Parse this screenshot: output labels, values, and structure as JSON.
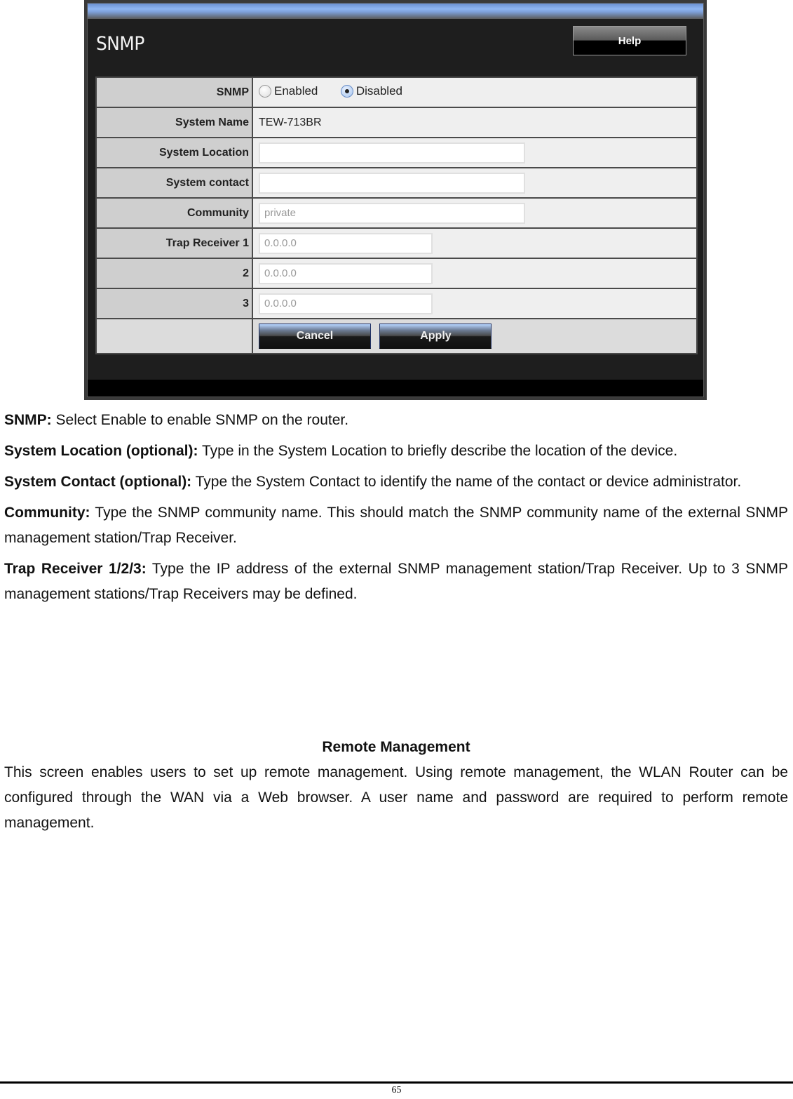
{
  "panel": {
    "title": "SNMP",
    "help_label": "Help",
    "rows": {
      "snmp": {
        "label": "SNMP",
        "options": [
          "Enabled",
          "Disabled"
        ],
        "selected": "Disabled"
      },
      "system_name": {
        "label": "System Name",
        "value": "TEW-713BR"
      },
      "system_location": {
        "label": "System Location",
        "value": ""
      },
      "system_contact": {
        "label": "System contact",
        "value": ""
      },
      "community": {
        "label": "Community",
        "value": "private"
      },
      "trap1": {
        "label": "Trap Receiver 1",
        "value": "0.0.0.0"
      },
      "trap2": {
        "label": "2",
        "value": "0.0.0.0"
      },
      "trap3": {
        "label": "3",
        "value": "0.0.0.0"
      }
    },
    "cancel_label": "Cancel",
    "apply_label": "Apply"
  },
  "doc": {
    "items": [
      {
        "term": "SNMP:",
        "text": " Select Enable to enable SNMP on the router."
      },
      {
        "term": "System Location (optional):",
        "text": " Type in the System Location to briefly describe the location of the device."
      },
      {
        "term": "System Contact (optional):",
        "text": " Type the System Contact to identify the name of the contact or device administrator."
      },
      {
        "term": "Community:",
        "text": " Type the SNMP community name. This should match the SNMP community name of the external SNMP management station/Trap Receiver."
      },
      {
        "term": "Trap Receiver 1/2/3:",
        "text": " Type the IP address of the external SNMP management station/Trap Receiver. Up to 3 SNMP management stations/Trap Receivers may be defined."
      }
    ],
    "section_heading": "Remote Management",
    "section_body": "This screen enables users to set up remote management. Using remote management, the WLAN Router can be configured through the WAN via a Web browser. A user name and password are required to perform remote management."
  },
  "footer": {
    "page_number": "65"
  }
}
